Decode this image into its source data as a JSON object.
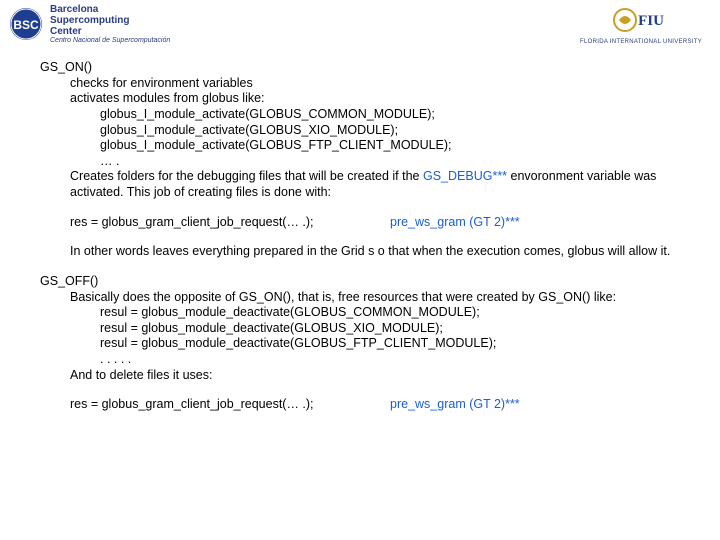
{
  "logos": {
    "bsc": {
      "abbr": "BSC",
      "line1": "Barcelona",
      "line2": "Supercomputing",
      "line3": "Center",
      "sub": "Centro Nacional de Supercomputación"
    },
    "fiu": {
      "abbr": "FIU",
      "sub": "FLORIDA INTERNATIONAL UNIVERSITY"
    }
  },
  "gs_on": {
    "title": "GS_ON()",
    "l1": "checks for environment variables",
    "l2": "activates modules from globus like:",
    "a1": "globus_I_module_activate(GLOBUS_COMMON_MODULE);",
    "a2": "globus_I_module_activate(GLOBUS_XIO_MODULE);",
    "a3": "globus_I_module_activate(GLOBUS_FTP_CLIENT_MODULE);",
    "a4": "… .",
    "p1a": "Creates folders for the debugging files that will be created if the ",
    "p1b": "GS_DEBUG***",
    "p1c": " envoronment variable was activated. This job of creating files is done with:",
    "res": "res = globus_gram_client_job_request(… .);",
    "pre": "pre_ws_gram (GT 2)***",
    "p2": "In other words leaves everything prepared in the Grid s o that when the execution comes, globus will allow it."
  },
  "gs_off": {
    "title": "GS_OFF()",
    "l1": "Basically does the opposite of GS_ON(), that is, free resources that were created by GS_ON() like:",
    "d1": "resul = globus_module_deactivate(GLOBUS_COMMON_MODULE);",
    "d2": "resul = globus_module_deactivate(GLOBUS_XIO_MODULE);",
    "d3": "resul = globus_module_deactivate(GLOBUS_FTP_CLIENT_MODULE);",
    "d4": ". . . . .",
    "l2": "And to delete files it uses:",
    "res": "res = globus_gram_client_job_request(… .);",
    "pre": "pre_ws_gram (GT 2)***"
  }
}
